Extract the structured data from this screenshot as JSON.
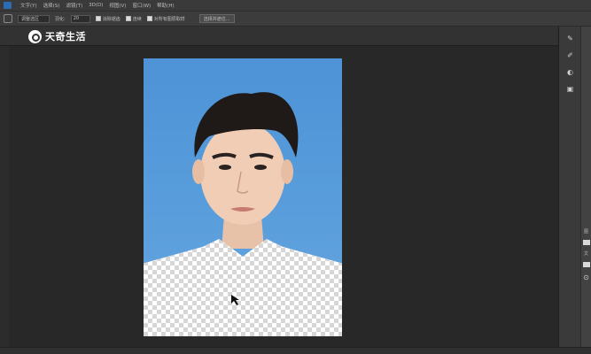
{
  "menu": {
    "items": [
      "文字(Y)",
      "选择(S)",
      "滤镜(T)",
      "3D(D)",
      "视图(V)",
      "窗口(W)",
      "帮助(H)"
    ]
  },
  "options": {
    "mode_value": "调整选区",
    "feather_label": "羽化:",
    "feather_value": "20",
    "antialias_label": "消除锯齿",
    "contiguous_label": "连续",
    "sample_all_label": "对所有图层取样",
    "select_subject_label": "选择并遮住..."
  },
  "watermark": {
    "text": "天奇生活"
  },
  "right_panel": {
    "icons": [
      "brush-icon",
      "paint-icon",
      "adjust-icon",
      "layers-icon"
    ],
    "labels": [
      "图",
      "文"
    ]
  },
  "colors": {
    "backdrop_blue": "#4d93d6",
    "canvas_bg": "#282828",
    "panel_bg": "#3a3a3a"
  }
}
